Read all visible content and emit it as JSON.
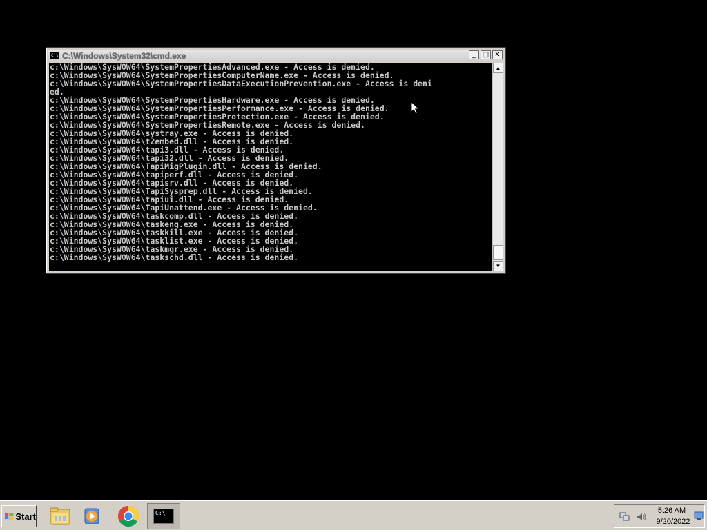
{
  "window": {
    "title": "C:\\Windows\\System32\\cmd.exe",
    "icon_text": "C:\\",
    "buttons": {
      "minimize": "_",
      "maximize": "□",
      "close": "✕"
    }
  },
  "console": {
    "lines": [
      "c:\\Windows\\SysWOW64\\SystemPropertiesAdvanced.exe - Access is denied.",
      "c:\\Windows\\SysWOW64\\SystemPropertiesComputerName.exe - Access is denied.",
      "c:\\Windows\\SysWOW64\\SystemPropertiesDataExecutionPrevention.exe - Access is deni",
      "ed.",
      "c:\\Windows\\SysWOW64\\SystemPropertiesHardware.exe - Access is denied.",
      "c:\\Windows\\SysWOW64\\SystemPropertiesPerformance.exe - Access is denied.",
      "c:\\Windows\\SysWOW64\\SystemPropertiesProtection.exe - Access is denied.",
      "c:\\Windows\\SysWOW64\\SystemPropertiesRemote.exe - Access is denied.",
      "c:\\Windows\\SysWOW64\\systray.exe - Access is denied.",
      "c:\\Windows\\SysWOW64\\t2embed.dll - Access is denied.",
      "c:\\Windows\\SysWOW64\\tapi3.dll - Access is denied.",
      "c:\\Windows\\SysWOW64\\tapi32.dll - Access is denied.",
      "c:\\Windows\\SysWOW64\\TapiMigPlugin.dll - Access is denied.",
      "c:\\Windows\\SysWOW64\\tapiperf.dll - Access is denied.",
      "c:\\Windows\\SysWOW64\\tapisrv.dll - Access is denied.",
      "c:\\Windows\\SysWOW64\\TapiSysprep.dll - Access is denied.",
      "c:\\Windows\\SysWOW64\\tapiui.dll - Access is denied.",
      "c:\\Windows\\SysWOW64\\TapiUnattend.exe - Access is denied.",
      "c:\\Windows\\SysWOW64\\taskcomp.dll - Access is denied.",
      "c:\\Windows\\SysWOW64\\taskeng.exe - Access is denied.",
      "c:\\Windows\\SysWOW64\\taskkill.exe - Access is denied.",
      "c:\\Windows\\SysWOW64\\tasklist.exe - Access is denied.",
      "c:\\Windows\\SysWOW64\\taskmgr.exe - Access is denied.",
      "c:\\Windows\\SysWOW64\\taskschd.dll - Access is denied."
    ]
  },
  "scrollbar": {
    "up_arrow": "▲",
    "down_arrow": "▼"
  },
  "taskbar": {
    "start_label": "Start",
    "icons": [
      "folder-icon",
      "media-player-icon",
      "chrome-icon",
      "cmd-icon"
    ],
    "cmd_icon_text": "C:\\_"
  },
  "tray": {
    "time": "5:26 AM",
    "date": "9/20/2022"
  }
}
